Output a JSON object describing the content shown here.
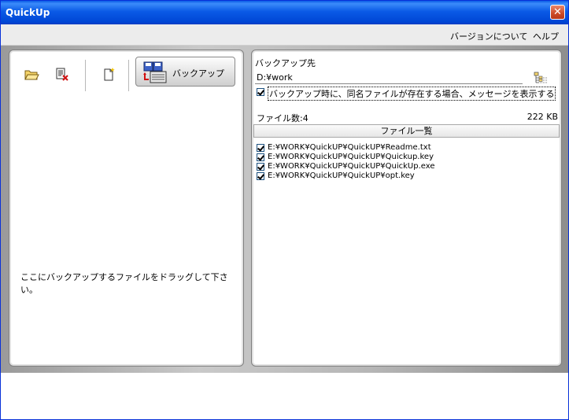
{
  "window": {
    "title": "QuickUp",
    "close_glyph": "✕"
  },
  "menu": {
    "items": [
      "バージョンについて",
      "ヘルプ"
    ]
  },
  "toolbar": {
    "icons": [
      "open-folder-icon",
      "remove-file-icon",
      "new-file-icon"
    ],
    "backup_button_label": "バックアップ",
    "backup_button_icon": "floppy-backup-icon"
  },
  "left_panel": {
    "drop_hint": "ここにバックアップするファイルをドラッグして下さい。"
  },
  "right_panel": {
    "dest_label": "バックアップ先",
    "dest_value": "D:¥work",
    "browse_icon": "folder-tree-icon",
    "option_label": "バックアップ時に、同名ファイルが存在する場合、メッセージを表示する",
    "option_checked": true,
    "file_count": "ファイル数:4",
    "total_size": "222 KB",
    "list_header": "ファイル一覧",
    "files": [
      {
        "name": "E:¥WORK¥QuickUP¥QuickUP¥Readme.txt",
        "checked": true
      },
      {
        "name": "E:¥WORK¥QuickUP¥QuickUP¥Quickup.key",
        "checked": true
      },
      {
        "name": "E:¥WORK¥QuickUP¥QuickUP¥QuickUp.exe",
        "checked": true
      },
      {
        "name": "E:¥WORK¥QuickUP¥QuickUP¥opt.key",
        "checked": true
      }
    ]
  },
  "colors": {
    "title_bar": "#0a5ae6",
    "close_button": "#cd4a26",
    "panel_bg": "#ffffff",
    "frame": "#b6b6b6"
  }
}
